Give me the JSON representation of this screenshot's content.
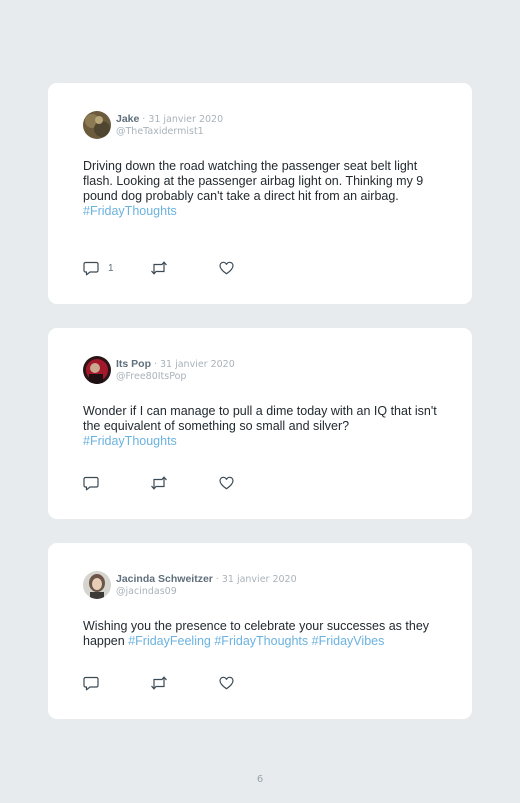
{
  "tweets": [
    {
      "author": "Jake",
      "date": "· 31 janvier 2020",
      "handle": "@TheTaxidermist1",
      "text": "Driving down the road watching the passenger seat belt light flash. Looking at the passenger airbag light on. Thinking my 9 pound dog probably can't take a direct hit from an airbag.",
      "hashtags": "#FridayThoughts",
      "reply_count": "1"
    },
    {
      "author": "Its Pop",
      "date": "· 31 janvier 2020",
      "handle": "@Free80ItsPop",
      "text": "Wonder if I can manage to pull a dime today with an IQ that isn't the equivalent of something so small and silver?",
      "hashtags": "#FridayThoughts"
    },
    {
      "author": "Jacinda Schweitzer",
      "date": "· 31 janvier 2020",
      "handle": "@jacindas09",
      "text": "Wishing you the presence to celebrate your successes as they happen",
      "hashtags": "#FridayFeeling #FridayThoughts #FridayVibes"
    }
  ],
  "page_number": "6",
  "colors": {
    "background": "#e7ebee",
    "card": "#ffffff",
    "hashtag": "#6ab2e0",
    "author_name": "#5f6f7b",
    "meta": "#a9b3ba",
    "body_text": "#222a30"
  },
  "icons": [
    "reply-icon",
    "retweet-icon",
    "like-icon"
  ]
}
